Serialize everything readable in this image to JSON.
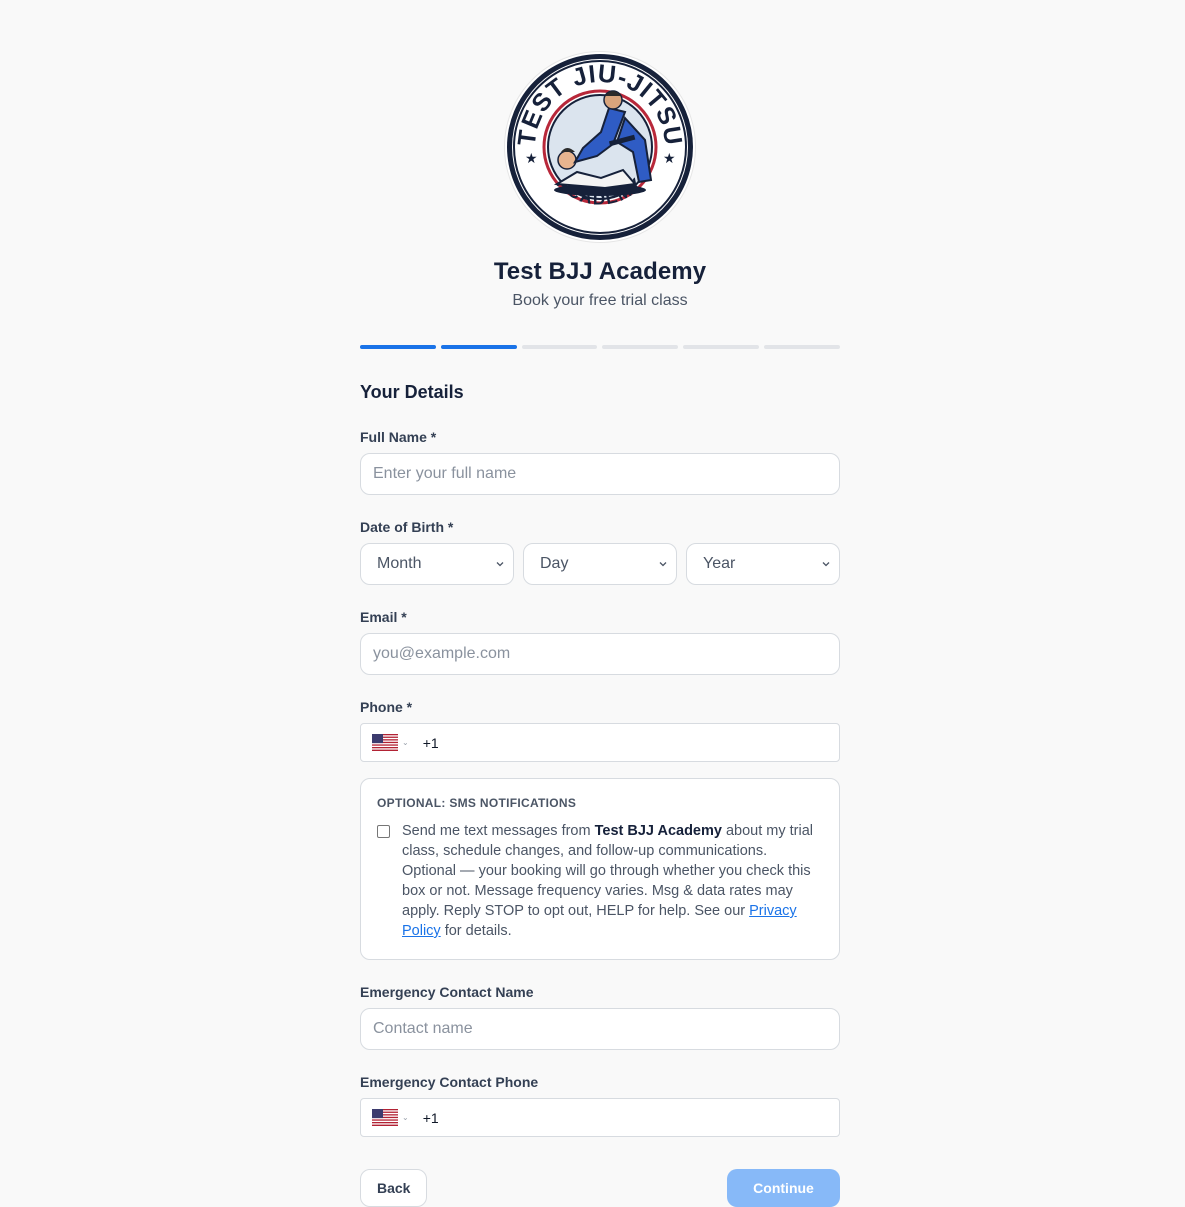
{
  "brand": {
    "name": "Test BJJ Academy",
    "subtitle": "Book your free trial class",
    "logo_top_text": "TEST JIU-JITSU",
    "logo_bottom_text": "ACADEMY"
  },
  "progress": {
    "total_steps": 6,
    "completed_steps": 2
  },
  "section_title": "Your Details",
  "fields": {
    "full_name": {
      "label": "Full Name",
      "required": "*",
      "placeholder": "Enter your full name",
      "value": ""
    },
    "dob": {
      "label": "Date of Birth",
      "required": "*",
      "month": "Month",
      "day": "Day",
      "year": "Year"
    },
    "email": {
      "label": "Email",
      "required": "*",
      "placeholder": "you@example.com",
      "value": ""
    },
    "phone": {
      "label": "Phone",
      "required": "*",
      "country": "us-flag-icon",
      "dial_code": "+1"
    },
    "emergency_name": {
      "label": "Emergency Contact Name",
      "placeholder": "Contact name",
      "value": ""
    },
    "emergency_phone": {
      "label": "Emergency Contact Phone",
      "country": "us-flag-icon",
      "dial_code": "+1"
    }
  },
  "sms": {
    "heading": "OPTIONAL: SMS NOTIFICATIONS",
    "text_before": "Send me text messages from ",
    "academy": "Test BJJ Academy",
    "text_after": " about my trial class, schedule changes, and follow-up communications. Optional — your booking will go through whether you check this box or not. Message frequency varies. Msg & data rates may apply. Reply STOP to opt out, HELP for help. See our ",
    "link_text": "Privacy Policy",
    "text_end": " for details.",
    "checked": false
  },
  "buttons": {
    "back": "Back",
    "continue": "Continue"
  },
  "colors": {
    "accent": "#1a73e8",
    "continue_disabled": "#87b9f8",
    "navy": "#16213a"
  }
}
